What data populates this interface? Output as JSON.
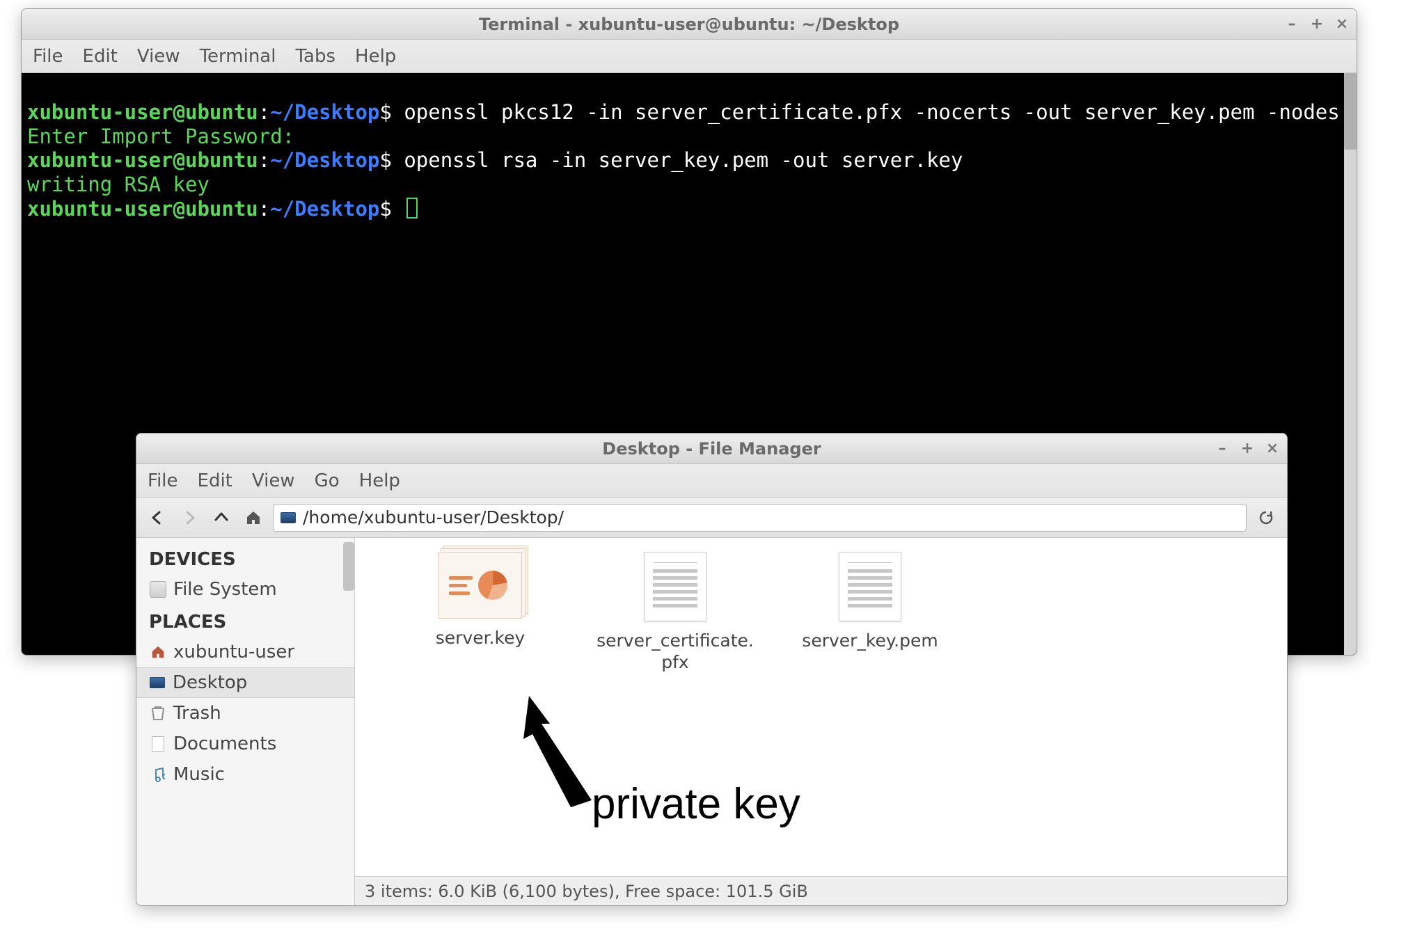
{
  "terminal": {
    "window_title": "Terminal - xubuntu-user@ubuntu: ~/Desktop",
    "menu": {
      "file": "File",
      "edit": "Edit",
      "view": "View",
      "terminal": "Terminal",
      "tabs": "Tabs",
      "help": "Help"
    },
    "prompt": {
      "user": "xubuntu-user",
      "at": "@",
      "host": "ubuntu",
      "colon": ":",
      "tilde": "~",
      "slash": "/",
      "dir": "Desktop",
      "dollar": "$"
    },
    "lines": {
      "cmd1": "openssl pkcs12 -in server_certificate.pfx -nocerts -out server_key.pem -nodes",
      "out1": "Enter Import Password:",
      "cmd2": "openssl rsa -in server_key.pem -out server.key",
      "out2": "writing RSA key"
    }
  },
  "file_manager": {
    "window_title": "Desktop - File Manager",
    "menu": {
      "file": "File",
      "edit": "Edit",
      "view": "View",
      "go": "Go",
      "help": "Help"
    },
    "path_value": "/home/xubuntu-user/Desktop/",
    "sidebar": {
      "devices_header": "DEVICES",
      "places_header": "PLACES",
      "items": {
        "filesystem": "File System",
        "home": "xubuntu-user",
        "desktop": "Desktop",
        "trash": "Trash",
        "documents": "Documents",
        "music": "Music"
      }
    },
    "files": [
      {
        "name": "server.key",
        "kind": "presentation"
      },
      {
        "name": "server_certificate.pfx",
        "kind": "doc"
      },
      {
        "name": "server_key.pem",
        "kind": "doc"
      }
    ],
    "status_text": "3 items: 6.0 KiB (6,100 bytes), Free space: 101.5 GiB"
  },
  "annotation": {
    "label": "private key"
  }
}
